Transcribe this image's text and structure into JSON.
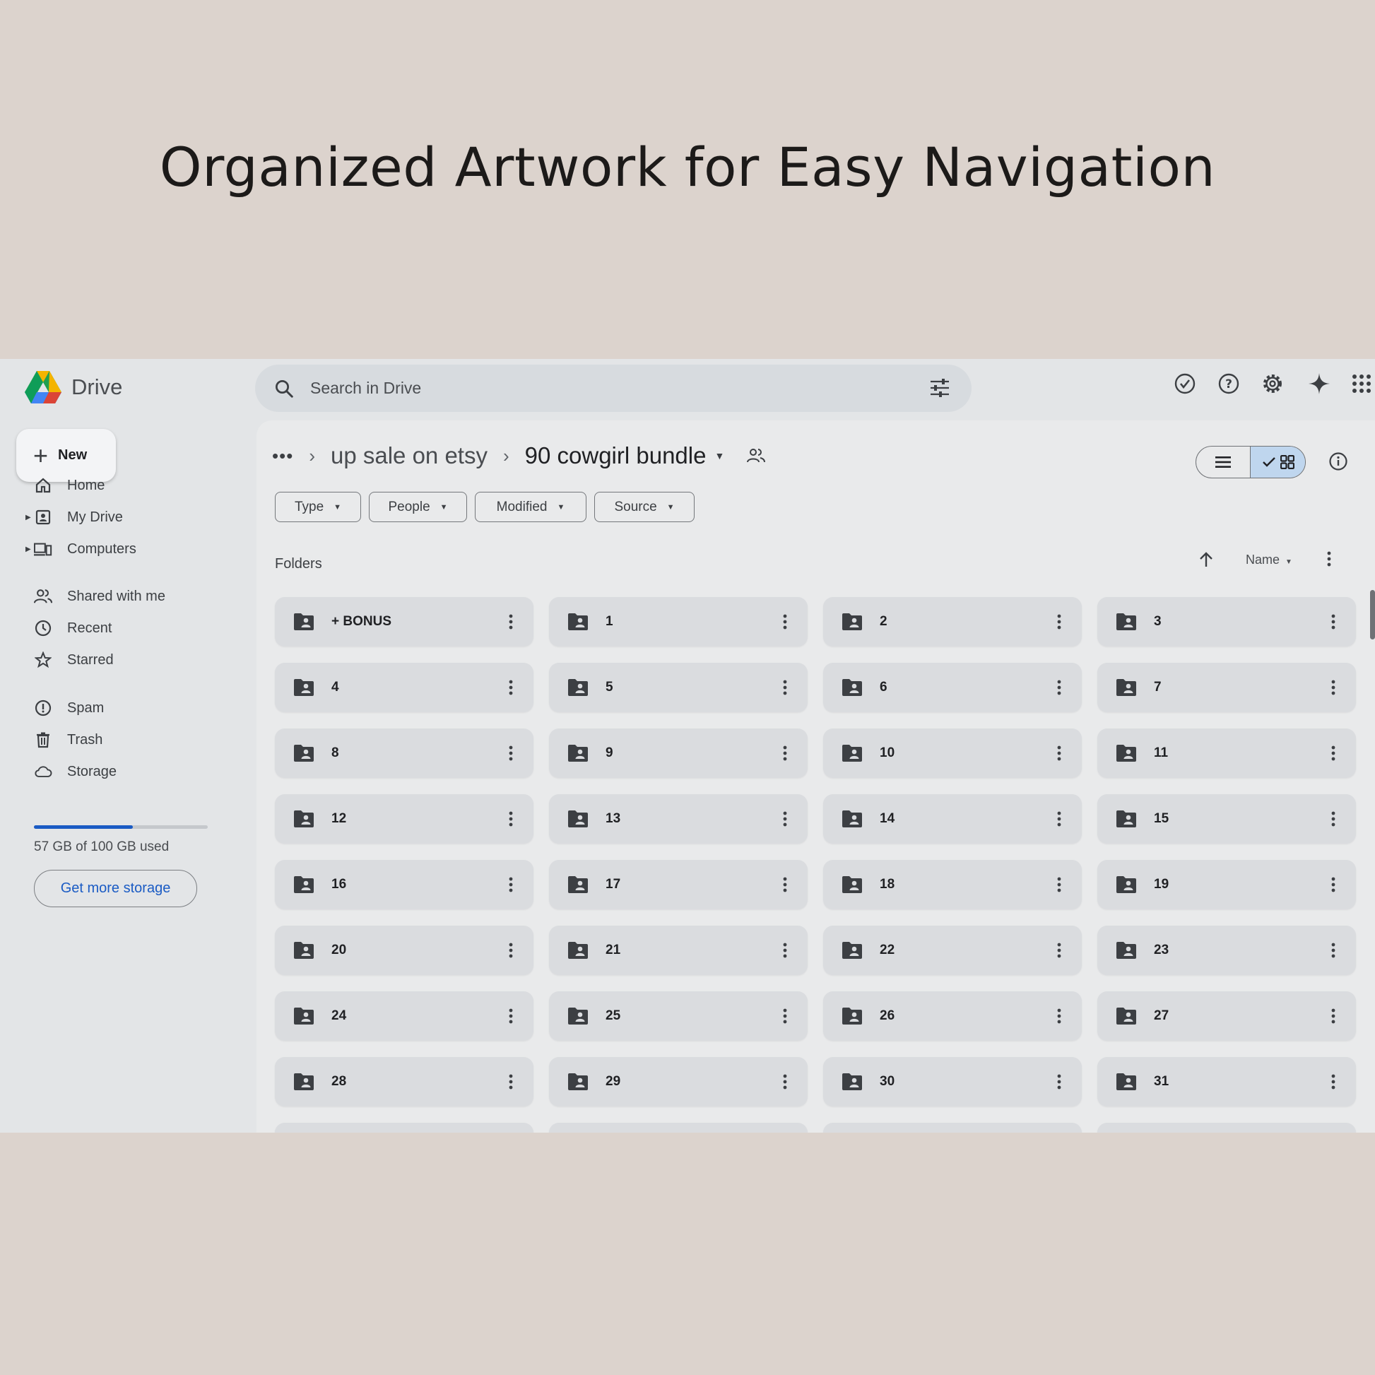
{
  "headline": "Organized Artwork for Easy Navigation",
  "app": {
    "name": "Drive",
    "search_placeholder": "Search in Drive",
    "top_icons": [
      "offline-status-icon",
      "help-icon",
      "settings-icon",
      "gemini-sparkle-icon",
      "apps-grid-icon"
    ]
  },
  "sidebar": {
    "new_label": "New",
    "items": [
      {
        "label": "Home",
        "icon": "home-icon",
        "caret": false
      },
      {
        "label": "My Drive",
        "icon": "my-drive-icon",
        "caret": true
      },
      {
        "label": "Computers",
        "icon": "computers-icon",
        "caret": true
      },
      {
        "label": "Shared with me",
        "icon": "shared-icon",
        "caret": false
      },
      {
        "label": "Recent",
        "icon": "recent-icon",
        "caret": false
      },
      {
        "label": "Starred",
        "icon": "star-icon",
        "caret": false
      },
      {
        "label": "Spam",
        "icon": "spam-icon",
        "caret": false
      },
      {
        "label": "Trash",
        "icon": "trash-icon",
        "caret": false
      },
      {
        "label": "Storage",
        "icon": "cloud-icon",
        "caret": false
      }
    ],
    "storage_text": "57 GB of 100 GB used",
    "storage_fraction": 0.57,
    "storage_button": "Get more storage"
  },
  "breadcrumb": {
    "more": "•••",
    "parent": "up sale on etsy",
    "current": "90 cowgirl bundle"
  },
  "filters": [
    "Type",
    "People",
    "Modified",
    "Source"
  ],
  "section_title": "Folders",
  "sort_label": "Name",
  "folders": [
    "+ BONUS",
    "1",
    "2",
    "3",
    "4",
    "5",
    "6",
    "7",
    "8",
    "9",
    "10",
    "11",
    "12",
    "13",
    "14",
    "15",
    "16",
    "17",
    "18",
    "19",
    "20",
    "21",
    "22",
    "23",
    "24",
    "25",
    "26",
    "27",
    "28",
    "29",
    "30",
    "31"
  ],
  "colors": {
    "accent": "#1a5bc4",
    "background": "#dcd3cd",
    "tile": "#dadcdf"
  }
}
